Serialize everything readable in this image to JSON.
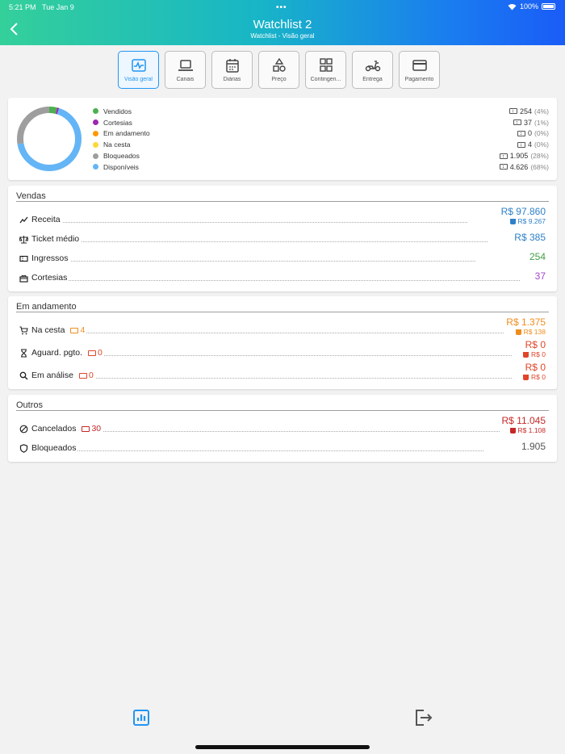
{
  "status": {
    "time": "5:21 PM",
    "date": "Tue Jan 9",
    "dots": "•••",
    "battery": "100%"
  },
  "header": {
    "title": "Watchlist 2",
    "subtitle": "Watchlist - Visão geral"
  },
  "tabs": [
    {
      "label": "Visão geral",
      "icon": "activity-icon",
      "active": true
    },
    {
      "label": "Canais",
      "icon": "laptop-icon",
      "active": false
    },
    {
      "label": "Diárias",
      "icon": "calendar-icon",
      "active": false
    },
    {
      "label": "Preço",
      "icon": "shapes-icon",
      "active": false
    },
    {
      "label": "Contingen...",
      "icon": "grid-icon",
      "active": false
    },
    {
      "label": "Entrega",
      "icon": "scooter-icon",
      "active": false
    },
    {
      "label": "Pagamento",
      "icon": "credit-card-icon",
      "active": false
    }
  ],
  "overview": {
    "items": [
      {
        "label": "Vendidos",
        "color": "#4caf50",
        "count": "254",
        "pct": "(4%)",
        "fraction": 0.04
      },
      {
        "label": "Cortesias",
        "color": "#9c27b0",
        "count": "37",
        "pct": "(1%)",
        "fraction": 0.01
      },
      {
        "label": "Em andamento",
        "color": "#ff9800",
        "count": "0",
        "pct": "(0%)",
        "fraction": 0.0
      },
      {
        "label": "Na cesta",
        "color": "#fdd835",
        "count": "4",
        "pct": "(0%)",
        "fraction": 0.0
      },
      {
        "label": "Bloqueados",
        "color": "#9e9e9e",
        "count": "1.905",
        "pct": "(28%)",
        "fraction": 0.28
      },
      {
        "label": "Disponíveis",
        "color": "#64b5f6",
        "count": "4.626",
        "pct": "(68%)",
        "fraction": 0.68
      }
    ]
  },
  "vendas": {
    "title": "Vendas",
    "receita": {
      "label": "Receita",
      "value": "R$ 97.860",
      "sub": "R$ 9.267"
    },
    "ticket": {
      "label": "Ticket médio",
      "value": "R$ 385"
    },
    "ingressos": {
      "label": "Ingressos",
      "value": "254"
    },
    "cortesias": {
      "label": "Cortesias",
      "value": "37"
    }
  },
  "andamento": {
    "title": "Em andamento",
    "cesta": {
      "label": "Na cesta",
      "count": "4",
      "value": "R$ 1.375",
      "sub": "R$ 138"
    },
    "aguard": {
      "label": "Aguard. pgto.",
      "count": "0",
      "value": "R$ 0",
      "sub": "R$ 0"
    },
    "analise": {
      "label": "Em análise",
      "count": "0",
      "value": "R$ 0",
      "sub": "R$ 0"
    }
  },
  "outros": {
    "title": "Outros",
    "cancelados": {
      "label": "Cancelados",
      "count": "30",
      "value": "R$ 11.045",
      "sub": "R$ 1.108"
    },
    "bloqueados": {
      "label": "Bloqueados",
      "value": "1.905"
    }
  },
  "colors": {
    "blue": "#2f80c8",
    "green": "#43a047",
    "purple": "#a347c8",
    "orange": "#f08c1e",
    "red": "#e0452a",
    "darkred": "#c62828",
    "grey": "#555555"
  }
}
